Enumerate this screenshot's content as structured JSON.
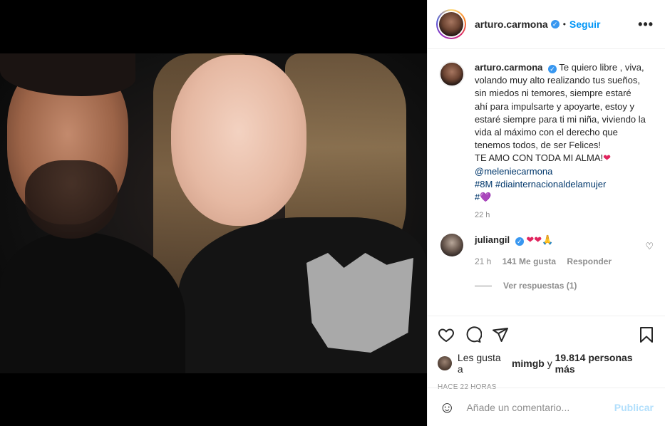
{
  "post": {
    "author": "arturo.carmona",
    "follow_label": "Seguir",
    "dot": "•",
    "more": "•••",
    "verified_mark": "✓"
  },
  "caption": {
    "user": "arturo.carmona",
    "text": "Te quiero libre , viva, volando muy alto realizando tus sueños, sin miedos ni temores, siempre estaré ahí para impulsarte y apoyarte, estoy y estaré siempre para ti mi niña, viviendo la vida al máximo con el derecho que tenemos todos, de ser Felices!",
    "love_line": "TE AMO CON TODA MI ALMA!",
    "mention": "@meleniecarmona",
    "hashtags": "#8M #diainternacionaldelamujer",
    "hash_prefix": "#",
    "red_heart": "❤",
    "purple_heart": "💜",
    "time": "22 h"
  },
  "comment": {
    "user": "juliangil",
    "text": "❤❤🙏",
    "time": "21 h",
    "likes": "141 Me gusta",
    "reply": "Responder",
    "view_replies": "Ver respuestas (1)",
    "like_icon": "♡"
  },
  "likes": {
    "prefix": "Les gusta a",
    "user": "mimgb",
    "connector": "y",
    "count_text": "19.814 personas más"
  },
  "posted_time": "HACE 22 HORAS",
  "add_comment": {
    "placeholder": "Añade un comentario...",
    "publish": "Publicar",
    "emoji_icon": "☺"
  },
  "icons": [
    "heart-icon",
    "comment-icon",
    "share-icon",
    "bookmark-icon",
    "more-icon",
    "verified-icon",
    "emoji-icon"
  ]
}
